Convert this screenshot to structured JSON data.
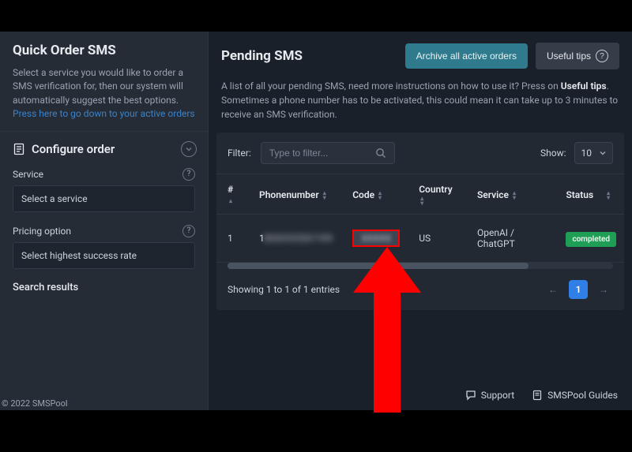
{
  "sidebar": {
    "quick_title": "Quick Order SMS",
    "quick_desc": "Select a service you would like to order a SMS verification for, then our system will automatically suggest the best options.",
    "quick_link": "Press here to go down to your active orders",
    "configure_title": "Configure order",
    "service_label": "Service",
    "service_placeholder": "Select a service",
    "pricing_label": "Pricing option",
    "pricing_placeholder": "Select highest success rate",
    "search_results": "Search results"
  },
  "main": {
    "title": "Pending SMS",
    "archive_btn": "Archive all active orders",
    "tips_btn": "Useful tips",
    "desc_1": "A list of all your pending SMS, need more instructions on how to use it? Press on ",
    "desc_bold": "Useful tips",
    "desc_2": ". Sometimes a phone number has to be activated, this could mean it can take up to 3 minutes to receive an SMS verification.",
    "filter_label": "Filter:",
    "filter_placeholder": "Type to filter...",
    "show_label": "Show:",
    "show_value": "10",
    "cols": {
      "idx": "#",
      "phone": "Phonenumber",
      "code": "Code",
      "country": "Country",
      "service": "Service",
      "status": "Status"
    },
    "row": {
      "idx": "1",
      "phone": "1",
      "country": "US",
      "service": "OpenAI / ChatGPT",
      "status": "completed"
    },
    "entries": "Showing 1 to 1 of 1 entries",
    "page": "1"
  },
  "footer": {
    "copyright": "© 2022 SMSPool",
    "support": "Support",
    "guides": "SMSPool Guides"
  }
}
